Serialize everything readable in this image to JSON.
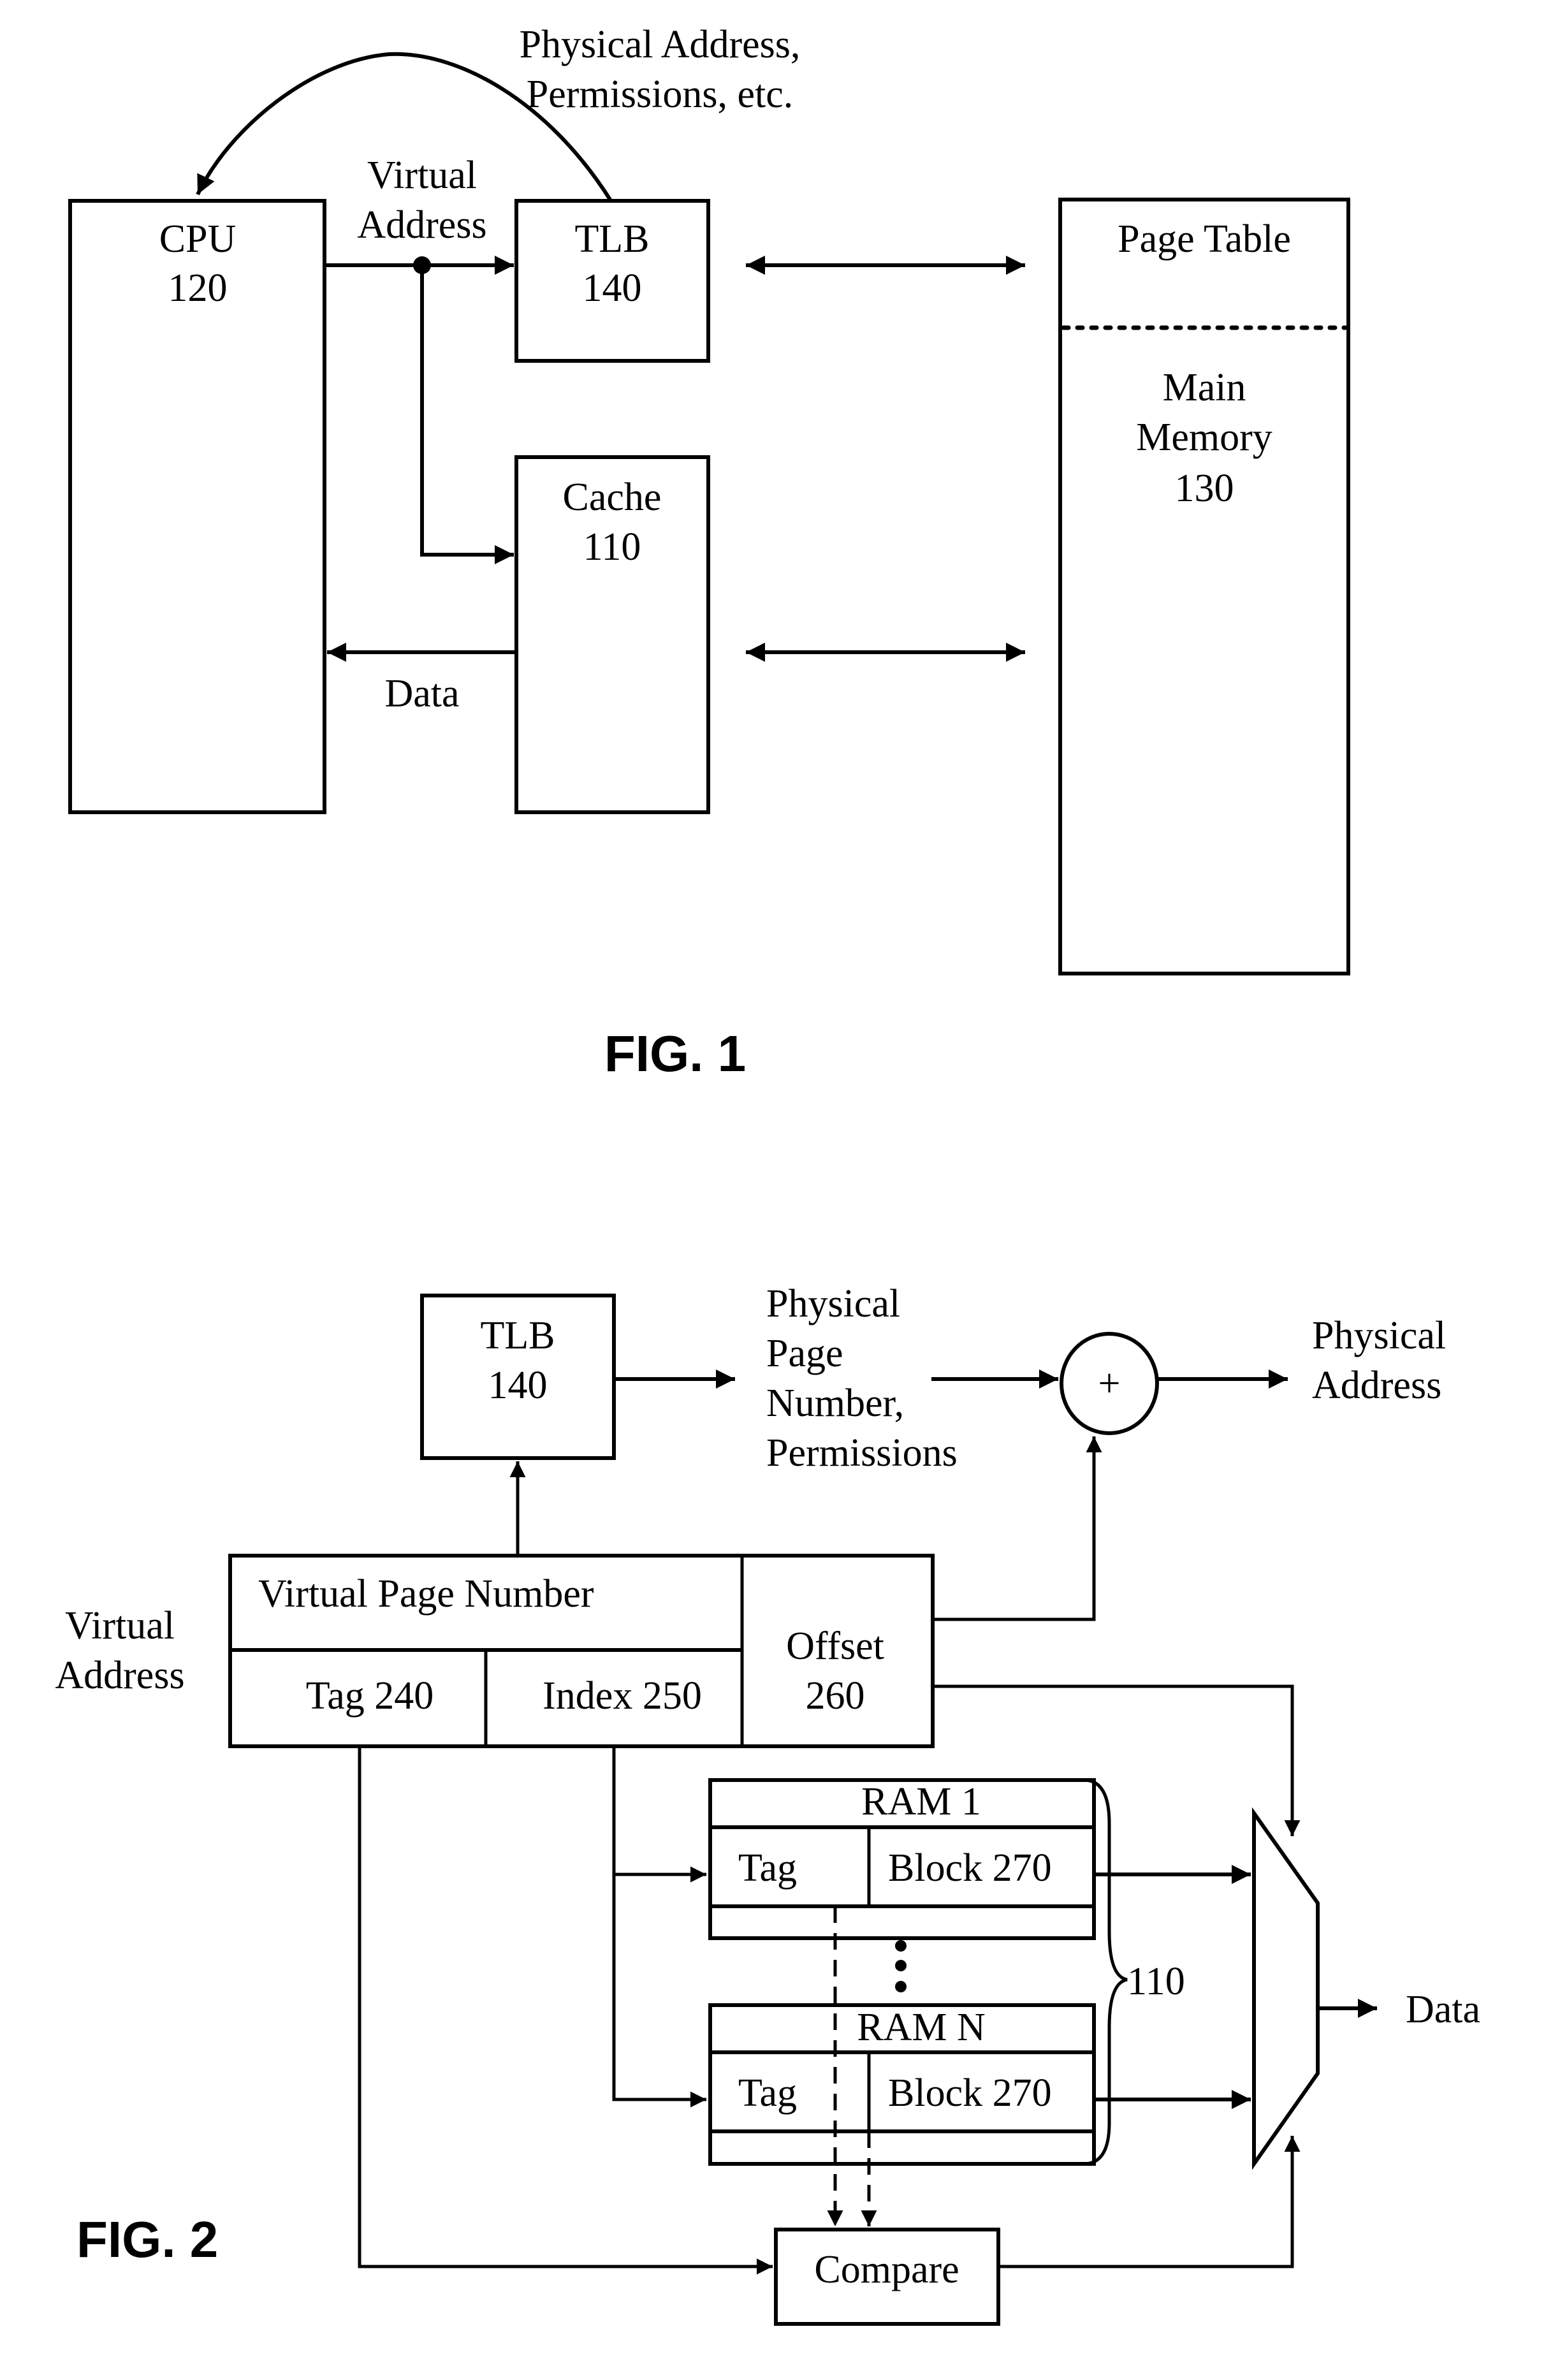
{
  "fig1": {
    "title": "FIG. 1",
    "cpu": {
      "name": "CPU",
      "ref": "120"
    },
    "tlb": {
      "name": "TLB",
      "ref": "140"
    },
    "cache": {
      "name": "Cache",
      "ref": "110"
    },
    "page_table": "Page Table",
    "main_memory": {
      "line1": "Main",
      "line2": "Memory",
      "ref": "130"
    },
    "virtual_address": {
      "line1": "Virtual",
      "line2": "Address"
    },
    "phys_addr_perm": {
      "line1": "Physical Address,",
      "line2": "Permissions, etc."
    },
    "data_label": "Data"
  },
  "fig2": {
    "title": "FIG. 2",
    "tlb": {
      "name": "TLB",
      "ref": "140"
    },
    "ppn": {
      "line1": "Physical",
      "line2": "Page",
      "line3": "Number,",
      "line4": "Permissions"
    },
    "adder_symbol": "+",
    "physical_address": {
      "line1": "Physical",
      "line2": "Address"
    },
    "virtual_address": {
      "line1": "Virtual",
      "line2": "Address"
    },
    "vpn": "Virtual Page Number",
    "tag": "Tag 240",
    "index": "Index 250",
    "offset": {
      "line1": "Offset",
      "line2": "260"
    },
    "ram1": {
      "title": "RAM 1",
      "tag": "Tag",
      "block": "Block 270"
    },
    "ramn": {
      "title": "RAM N",
      "tag": "Tag",
      "block": "Block 270"
    },
    "cache_ref": "110",
    "data_label": "Data",
    "compare": "Compare"
  }
}
